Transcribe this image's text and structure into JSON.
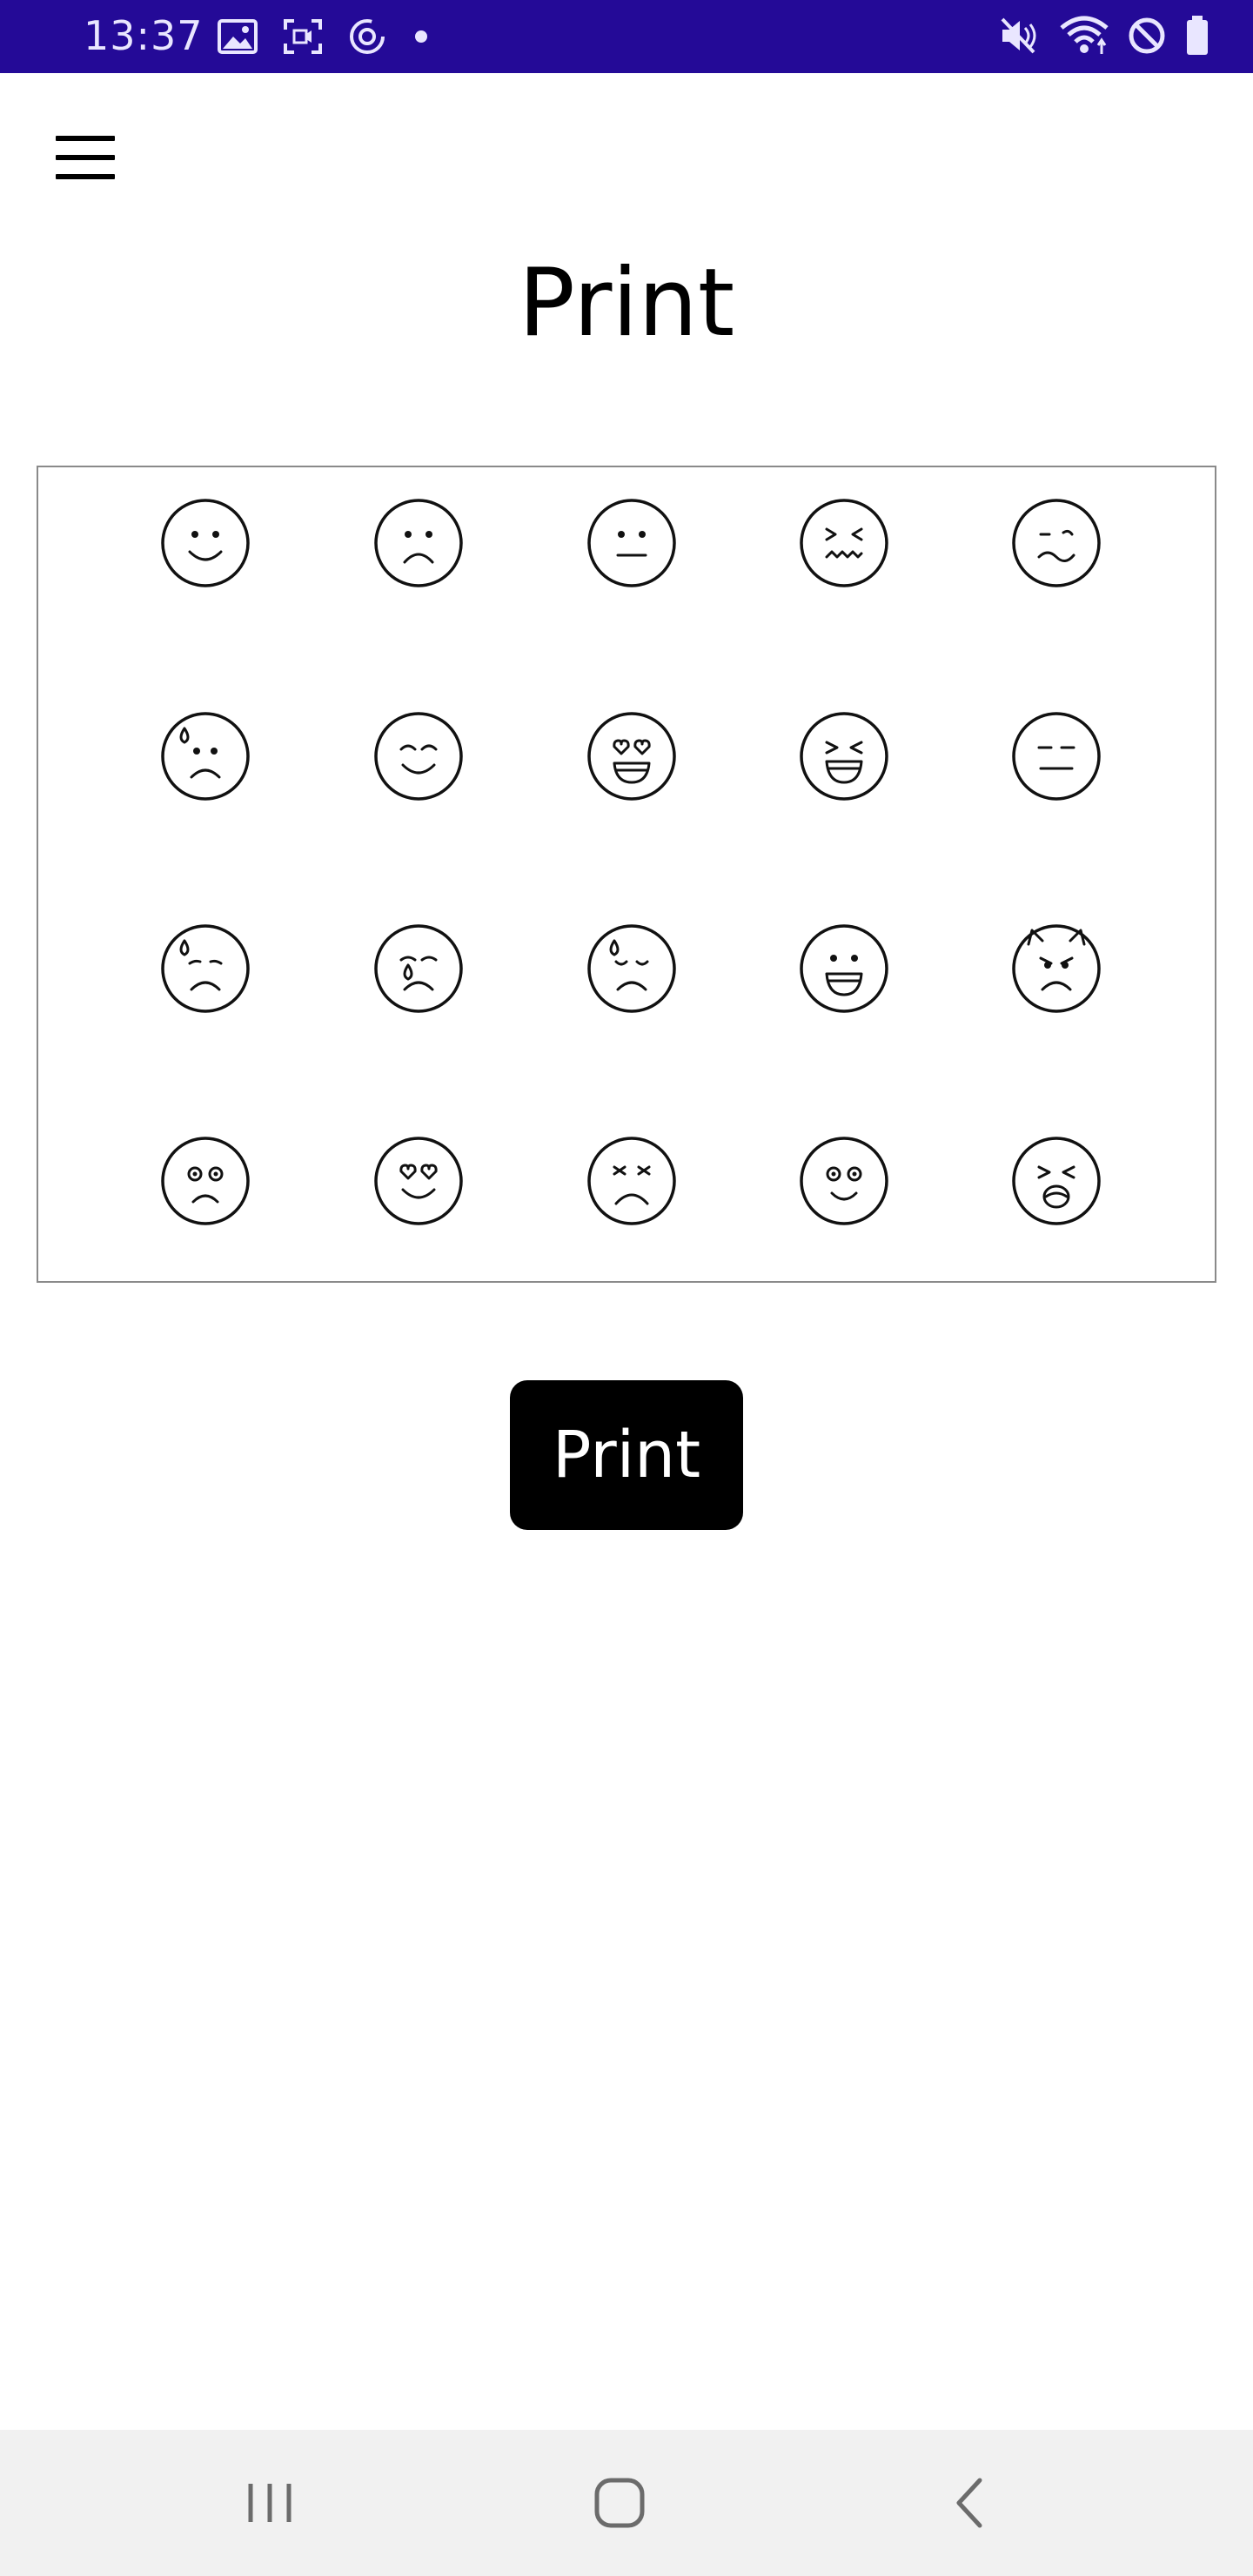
{
  "status_bar": {
    "time": "13:37",
    "background_color": "#240a97",
    "left_icons": [
      "gallery-icon",
      "screen-record-icon",
      "sync-icon",
      "notification-dot-icon"
    ],
    "right_icons": [
      "mute-icon",
      "wifi-icon",
      "do-not-disturb-icon",
      "battery-icon"
    ]
  },
  "header": {
    "menu_icon": "hamburger-menu-icon",
    "title": "Print"
  },
  "emoji_grid": {
    "rows": [
      [
        "smile",
        "frown",
        "neutral",
        "confounded",
        "woozy"
      ],
      [
        "sweat-frown",
        "happy-closed-eyes",
        "heart-eyes-grin",
        "laughing-squint",
        "expressionless"
      ],
      [
        "anxious-sweat",
        "crying-tear",
        "downcast-sweat",
        "grinning",
        "angry-devil"
      ],
      [
        "dizzy-frown",
        "heart-eyes-smile",
        "angry-squint",
        "dizzy-smile",
        "shouting"
      ]
    ]
  },
  "actions": {
    "print_label": "Print"
  },
  "nav_bar": {
    "icons": [
      "recent-apps-icon",
      "home-icon",
      "back-icon"
    ]
  }
}
